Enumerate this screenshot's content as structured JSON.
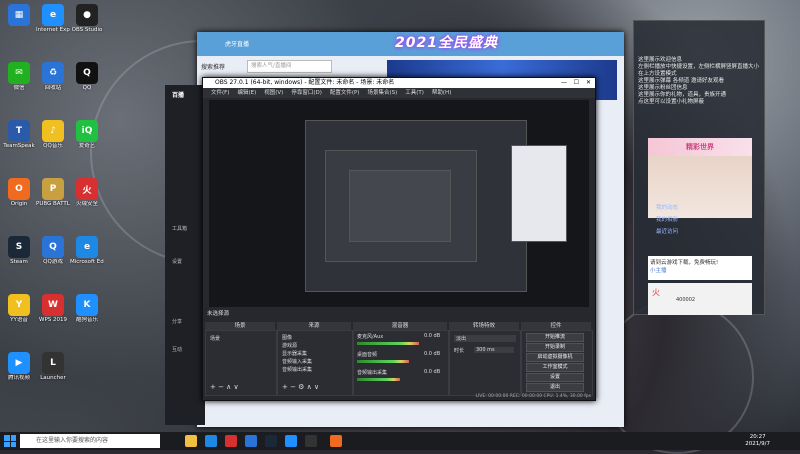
{
  "desktop_icons": [
    {
      "label": "",
      "color": "#2a74d8",
      "glyph": "▦"
    },
    {
      "label": "Internet Explorer",
      "color": "#1e90ff",
      "glyph": "e"
    },
    {
      "label": "OBS Studio",
      "color": "#222",
      "glyph": "●"
    },
    {
      "label": "微信",
      "color": "#20b020",
      "glyph": "✉"
    },
    {
      "label": "回收站",
      "color": "#2a74d8",
      "glyph": "♻"
    },
    {
      "label": "QQ",
      "color": "#111",
      "glyph": "Q"
    },
    {
      "label": "TeamSpeak",
      "color": "#2a5aa8",
      "glyph": "T"
    },
    {
      "label": "QQ音乐",
      "color": "#f0c020",
      "glyph": "♪"
    },
    {
      "label": "爱奇艺",
      "color": "#20c040",
      "glyph": "iQ"
    },
    {
      "label": "Origin",
      "color": "#f06a20",
      "glyph": "O"
    },
    {
      "label": "PUBG BATTLEGR...",
      "color": "#c8a040",
      "glyph": "P"
    },
    {
      "label": "火绒安全",
      "color": "#d83030",
      "glyph": "火"
    },
    {
      "label": "Steam",
      "color": "#1b2838",
      "glyph": "S"
    },
    {
      "label": "QQ游戏",
      "color": "#2a74d8",
      "glyph": "Q"
    },
    {
      "label": "Microsoft Edge",
      "color": "#1e88e5",
      "glyph": "e"
    },
    {
      "label": "YY语音",
      "color": "#f0c020",
      "glyph": "Y"
    },
    {
      "label": "WPS 2019",
      "color": "#d83030",
      "glyph": "W"
    },
    {
      "label": "酷狗音乐",
      "color": "#1e90ff",
      "glyph": "K"
    },
    {
      "label": "腾讯视频",
      "color": "#1e90ff",
      "glyph": "▶"
    },
    {
      "label": "Launcher",
      "color": "#333",
      "glyph": "L"
    }
  ],
  "browser": {
    "title": "虎牙直播",
    "search_label": "搜索推荐",
    "search_placeholder": "搜索人气/直播间",
    "banner_text": "2021全民盛典"
  },
  "app_panel": {
    "logo": "百播",
    "items": [
      "工具箱",
      "设置",
      "分享",
      "互动"
    ]
  },
  "obs": {
    "title": "OBS 27.0.1 (64-bit, windows) - 配置文件: 未命名 - 场景: 未命名",
    "menu": [
      "文件(F)",
      "编辑(E)",
      "视图(V)",
      "停靠窗口(D)",
      "配置文件(P)",
      "场景集合(S)",
      "工具(T)",
      "帮助(H)"
    ],
    "scene_label": "未选择源",
    "docks": {
      "scenes_title": "场景",
      "sources_title": "来源",
      "mixer_title": "混音器",
      "transitions_title": "转场特效",
      "controls_title": "控件"
    },
    "scene_items": [
      "场景"
    ],
    "sources": [
      "图像",
      "游戏源",
      "显示器采集",
      "音频输入采集",
      "音频输出采集"
    ],
    "mixer": [
      {
        "name": "麦克风/Aux",
        "level": "0.0 dB",
        "fill": 0.72
      },
      {
        "name": "桌面音频",
        "level": "0.0 dB",
        "fill": 0.6
      },
      {
        "name": "音频输出采集",
        "level": "0.0 dB",
        "fill": 0.5
      }
    ],
    "transition": {
      "type": "淡出",
      "duration_label": "时长",
      "duration_value": "300 ms"
    },
    "controls": [
      "开始推流",
      "开始录制",
      "启动虚拟摄像机",
      "工作室模式",
      "设置",
      "退出"
    ],
    "status": "LIVE: 00:00:00   REC: 00:00:00   CPU: 1.4%, 30.00 fps"
  },
  "chat": {
    "intro_lines": [
      "这里展示欢迎信息",
      "左侧栏播放中快捷设置，左侧栏横屏竖屏直播大小",
      "在上方设置模式",
      "这里展示弹幕 各频道 邀请好友观看",
      "这里展示粉丝团信息",
      "这里展示你的礼物，道具，贵族开通",
      "点这里可以设置小礼物屏蔽"
    ],
    "banner": "精彩世界",
    "links": [
      "我的动态",
      "我的相册",
      "最近访问"
    ],
    "message": "请到云游戏下载，免费畅玩!",
    "message_user": "小主播",
    "card_label": "火",
    "card_sub": "400002"
  },
  "taskbar": {
    "search_placeholder": "在这里输入你要搜索的内容",
    "time": "20:27",
    "date": "2021/9/7"
  }
}
